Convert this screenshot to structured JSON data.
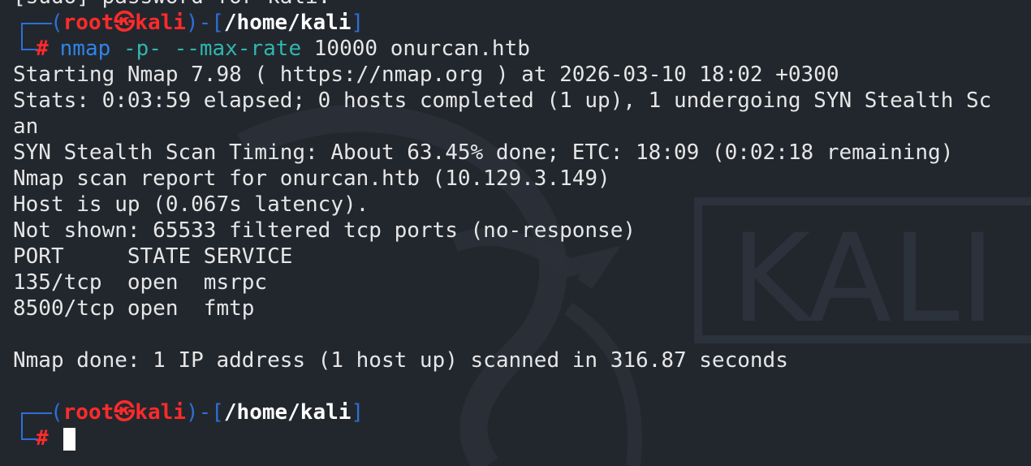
{
  "terminal": {
    "prev_line": "[sudo] password for kali:",
    "prompt1": {
      "open": "(",
      "user": "root",
      "at_symbol": "㉿",
      "host": "kali",
      "close": ")",
      "dash": "-",
      "bracket_open": "[",
      "path": "/home/kali",
      "bracket_close": "]",
      "hash": "#"
    },
    "command": {
      "program": "nmap",
      "flag1": "-p-",
      "flag2": "--max-rate",
      "arg1": "10000",
      "arg2": "onurcan.htb"
    },
    "output": [
      "Starting Nmap 7.98 ( https://nmap.org ) at 2026-03-10 18:02 +0300",
      "Stats: 0:03:59 elapsed; 0 hosts completed (1 up), 1 undergoing SYN Stealth Sc",
      "an",
      "SYN Stealth Scan Timing: About 63.45% done; ETC: 18:09 (0:02:18 remaining)",
      "Nmap scan report for onurcan.htb (10.129.3.149)",
      "Host is up (0.067s latency).",
      "Not shown: 65533 filtered tcp ports (no-response)",
      "PORT     STATE SERVICE",
      "135/tcp  open  msrpc",
      "8500/tcp open  fmtp",
      "",
      "Nmap done: 1 IP address (1 host up) scanned in 316.87 seconds",
      ""
    ],
    "prompt2": {
      "open": "(",
      "user": "root",
      "at_symbol": "㉿",
      "host": "kali",
      "close": ")",
      "dash": "-",
      "bracket_open": "[",
      "path": "/home/kali",
      "bracket_close": "]",
      "hash": "#"
    },
    "watermark_text": "KALI"
  }
}
